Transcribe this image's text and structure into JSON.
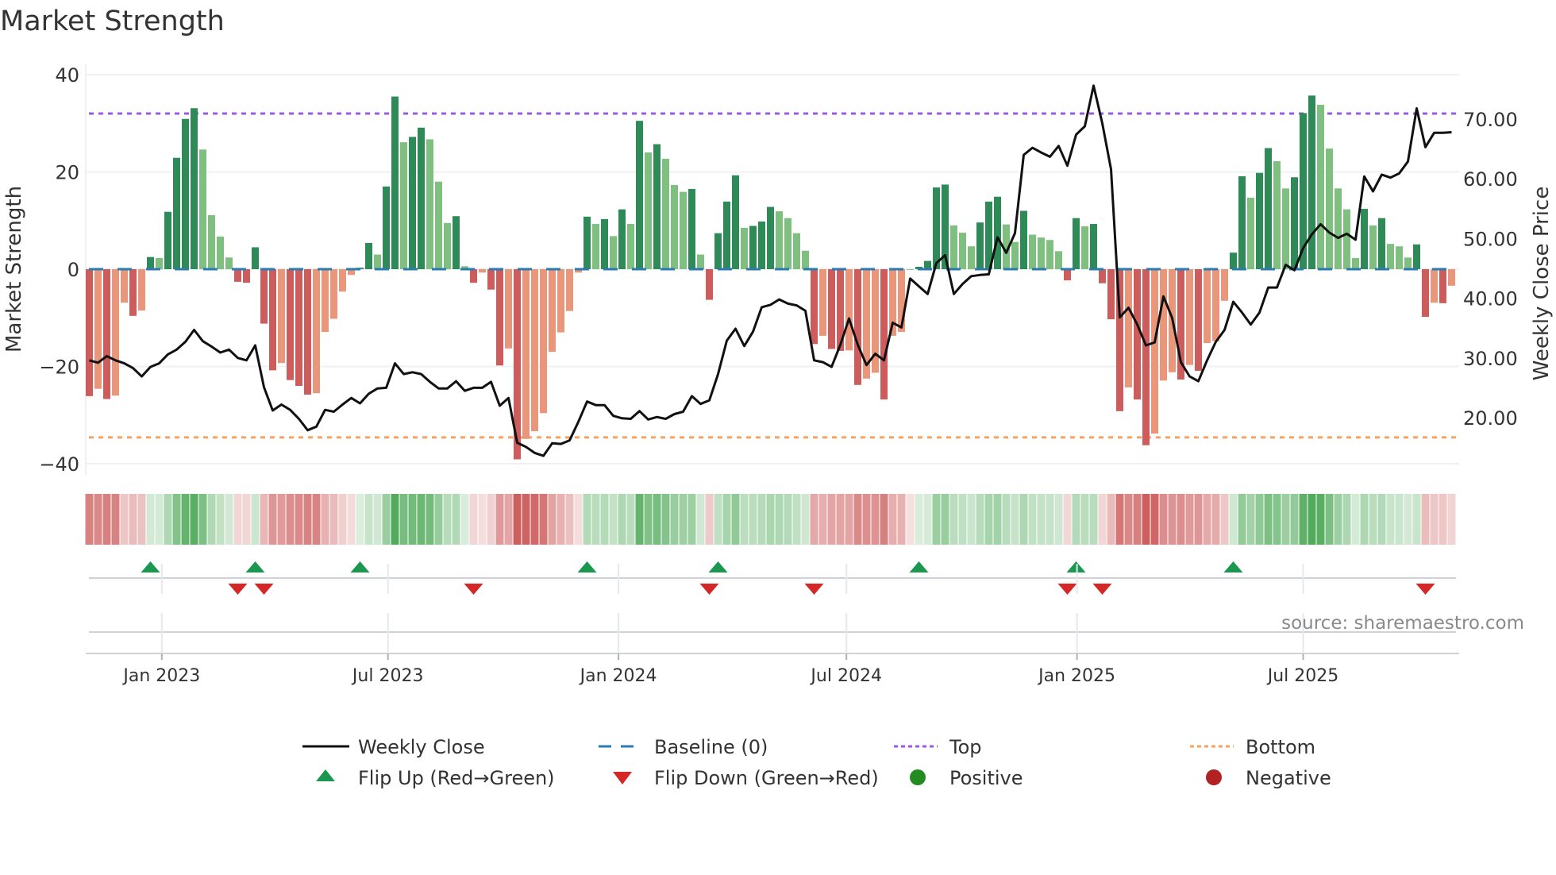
{
  "title": "Market Strength",
  "source": "source: sharemaestro.com",
  "colors": {
    "rise_pos": "#2e8b57",
    "fall_pos": "#7fbf7f",
    "fall_neg": "#cd5c5c",
    "rise_neg": "#e9967a",
    "top": "#9b59e6",
    "bottom": "#f4a261",
    "baseline": "#2b7bb0",
    "flip_up": "#1a9850",
    "flip_down": "#d62728",
    "positive": "#228b22",
    "negative": "#b22222",
    "close": "#111111"
  },
  "legend": {
    "weekly_close": "Weekly Close",
    "baseline": "Baseline (0)",
    "top": "Top",
    "bottom": "Bottom",
    "flip_up": "Flip Up (Red→Green)",
    "flip_down": "Flip Down (Green→Red)",
    "positive": "Positive",
    "negative": "Negative"
  },
  "chart_data": {
    "type": "bar+line",
    "title": "Market Strength",
    "ylabel": "Market Strength",
    "y2label": "Weekly Close Price",
    "ylim": [
      -42,
      42
    ],
    "y2lim": [
      13.8,
      79.6
    ],
    "yticks": [
      40,
      20,
      0,
      -20,
      -40
    ],
    "yticklabels": [
      "40",
      "20",
      "0",
      "−20",
      "−40"
    ],
    "y2ticks": [
      70,
      60,
      50,
      40,
      30,
      20
    ],
    "y2ticklabels": [
      "70.00",
      "60.00",
      "50.00",
      "40.00",
      "30.00",
      "20.00"
    ],
    "top_level": 32,
    "bottom_level": -34.6,
    "baseline": 0,
    "grid": true,
    "legend_position": "bottom",
    "x_unit": "week index",
    "xticks": [
      {
        "week": 9.3,
        "label": "Jan 2023"
      },
      {
        "week": 35.2,
        "label": "Jul 2023"
      },
      {
        "week": 61.6,
        "label": "Jan 2024"
      },
      {
        "week": 87.7,
        "label": "Jul 2024"
      },
      {
        "week": 114.1,
        "label": "Jan 2025"
      },
      {
        "week": 140.0,
        "label": "Jul 2025"
      }
    ],
    "strength": [
      -26.1,
      -24.6,
      -26.7,
      -26,
      -6.9,
      -9.6,
      -8.5,
      2.5,
      2.3,
      11.8,
      22.9,
      30.9,
      33.1,
      24.6,
      11.1,
      6.7,
      2.4,
      -2.6,
      -2.8,
      4.5,
      -11.2,
      -20.8,
      -19.3,
      -22.8,
      -24,
      -25.8,
      -25.5,
      -12.9,
      -10.2,
      -4.6,
      -1.2,
      0.3,
      5.4,
      3,
      17,
      35.5,
      26.1,
      27.2,
      29.1,
      26.7,
      18,
      9.5,
      10.9,
      0.6,
      -2.8,
      -0.7,
      -4.2,
      -19.8,
      -16.3,
      -39.1,
      -34.9,
      -33.3,
      -29.6,
      -17,
      -13,
      -8.6,
      -0.7,
      10.8,
      9.3,
      10.3,
      6.8,
      12.3,
      9.3,
      30.5,
      24,
      25.7,
      22.7,
      17.3,
      15.9,
      16.5,
      3,
      -6.3,
      7.4,
      13.9,
      19.3,
      8.5,
      8.9,
      9.8,
      12.8,
      11.9,
      10.5,
      7.4,
      3.8,
      -15.4,
      -13.7,
      -16.4,
      -16.8,
      -16.7,
      -23.8,
      -22.5,
      -21.3,
      -26.8,
      -13.7,
      -12.9,
      0,
      0.5,
      1.7,
      16.8,
      17.4,
      9,
      7.5,
      4.7,
      9.6,
      13.9,
      14.9,
      9.2,
      5.6,
      12,
      7.1,
      6.5,
      6,
      3.7,
      -2.3,
      10.5,
      8.8,
      9.3,
      -2.9,
      -10.3,
      -29.2,
      -24.3,
      -26.8,
      -36.2,
      -33.8,
      -22.9,
      -21.2,
      -22.7,
      -19.7,
      -20.9,
      -15.2,
      -14.8,
      -6.5,
      3.4,
      19.1,
      14.7,
      19.8,
      24.9,
      22.2,
      16.6,
      18.9,
      32.1,
      35.7,
      33.8,
      24.8,
      16.6,
      12.3,
      2.3,
      12.4,
      9,
      10.5,
      5.2,
      4.7,
      2.4,
      5.1,
      -9.8,
      -6.9,
      -7,
      -3.4
    ],
    "close": [
      29.6,
      29.2,
      30.3,
      29.6,
      29.1,
      28.3,
      26.9,
      28.5,
      29.1,
      30.6,
      31.4,
      32.7,
      34.7,
      32.8,
      31.9,
      30.9,
      31.4,
      30,
      29.6,
      32.1,
      25.1,
      21.2,
      22.2,
      21.3,
      19.8,
      17.9,
      18.5,
      21.3,
      21,
      22.2,
      23.3,
      22.4,
      24,
      24.9,
      25,
      29.1,
      27.3,
      27.6,
      27.3,
      26,
      24.9,
      24.9,
      26.1,
      24.5,
      25,
      25,
      26,
      22,
      23.3,
      15.8,
      15.1,
      14.1,
      13.6,
      15.7,
      15.6,
      16.2,
      19.3,
      22.7,
      22.1,
      22.1,
      20.3,
      19.9,
      19.8,
      21.1,
      19.7,
      20.1,
      19.8,
      20.6,
      21,
      23.6,
      22.3,
      22.9,
      27.3,
      32.9,
      34.9,
      32,
      34.4,
      38.5,
      38.9,
      39.8,
      39.1,
      38.8,
      37.9,
      29.6,
      29.3,
      28.5,
      32.2,
      36.6,
      32.2,
      28.8,
      30.7,
      29.6,
      35.9,
      35.1,
      43.3,
      42,
      40.7,
      45.9,
      47.2,
      40.7,
      42.4,
      43.7,
      43.9,
      44,
      50.2,
      47.6,
      50.9,
      64,
      65.2,
      64.4,
      63.7,
      65.5,
      62.2,
      67.4,
      68.8,
      75.6,
      69.3,
      61.6,
      36.8,
      38.4,
      35.6,
      32.1,
      32.6,
      40.3,
      36.7,
      29.3,
      26.9,
      26.1,
      29.6,
      32.7,
      34.7,
      39.4,
      37.6,
      35.6,
      37.6,
      41.8,
      41.8,
      45.6,
      44.7,
      48.4,
      50.7,
      52.4,
      51,
      50.1,
      50.8,
      49.8,
      60.4,
      57.9,
      60.7,
      60.2,
      60.9,
      62.9,
      71.8,
      65.3,
      67.7,
      67.7,
      67.8
    ]
  }
}
